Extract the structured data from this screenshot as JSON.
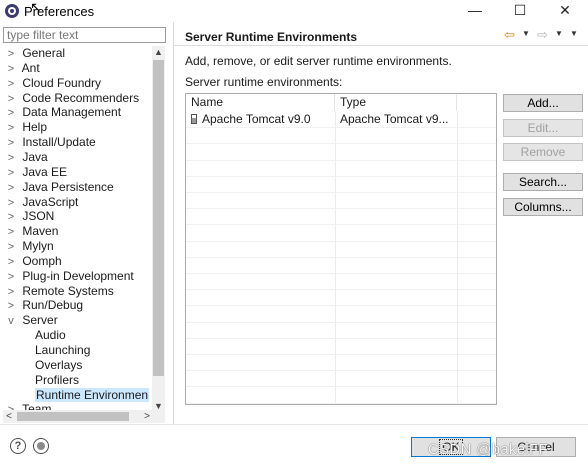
{
  "window": {
    "title": "Preferences",
    "minimize_glyph": "—",
    "maximize_glyph": "☐",
    "close_glyph": "✕"
  },
  "filter": {
    "placeholder": "type filter text",
    "value": ""
  },
  "tree": {
    "items": [
      {
        "label": "General",
        "toggle": ">"
      },
      {
        "label": "Ant",
        "toggle": ">"
      },
      {
        "label": "Cloud Foundry",
        "toggle": ">"
      },
      {
        "label": "Code Recommenders",
        "toggle": ">"
      },
      {
        "label": "Data Management",
        "toggle": ">"
      },
      {
        "label": "Help",
        "toggle": ">"
      },
      {
        "label": "Install/Update",
        "toggle": ">"
      },
      {
        "label": "Java",
        "toggle": ">"
      },
      {
        "label": "Java EE",
        "toggle": ">"
      },
      {
        "label": "Java Persistence",
        "toggle": ">"
      },
      {
        "label": "JavaScript",
        "toggle": ">"
      },
      {
        "label": "JSON",
        "toggle": ">"
      },
      {
        "label": "Maven",
        "toggle": ">"
      },
      {
        "label": "Mylyn",
        "toggle": ">"
      },
      {
        "label": "Oomph",
        "toggle": ">"
      },
      {
        "label": "Plug-in Development",
        "toggle": ">"
      },
      {
        "label": "Remote Systems",
        "toggle": ">"
      },
      {
        "label": "Run/Debug",
        "toggle": ">"
      },
      {
        "label": "Server",
        "toggle": "v"
      }
    ],
    "server_children": [
      "Audio",
      "Launching",
      "Overlays",
      "Profilers",
      "Runtime Environmen"
    ],
    "partial_item": {
      "label": "Team",
      "toggle": ">"
    },
    "selected": "Runtime Environmen"
  },
  "page": {
    "title": "Server Runtime Environments",
    "description": "Add, remove, or edit server runtime environments.",
    "list_label": "Server runtime environments:",
    "table": {
      "columns": [
        "Name",
        "Type"
      ],
      "rows": [
        {
          "name": "Apache Tomcat v9.0",
          "type": "Apache Tomcat v9..."
        }
      ]
    },
    "buttons": {
      "add": "Add...",
      "edit": "Edit...",
      "remove": "Remove",
      "search": "Search...",
      "columns": "Columns..."
    },
    "nav": {
      "back_icon": "⇦",
      "forward_icon": "⇨",
      "dropdown": "▼"
    }
  },
  "footer": {
    "help_glyph": "?",
    "ok": "OK",
    "cancel": "Cancel",
    "watermark": "CSDN @bakelFF"
  },
  "icons": [
    "eclipse-app-icon",
    "help-icon",
    "record-macro-icon",
    "jar-icon",
    "back-arrow-icon",
    "forward-arrow-icon"
  ],
  "colors": {
    "selection": "#cce8ff",
    "back_arrow": "#d08a10",
    "default_button_border": "#0078d7"
  }
}
